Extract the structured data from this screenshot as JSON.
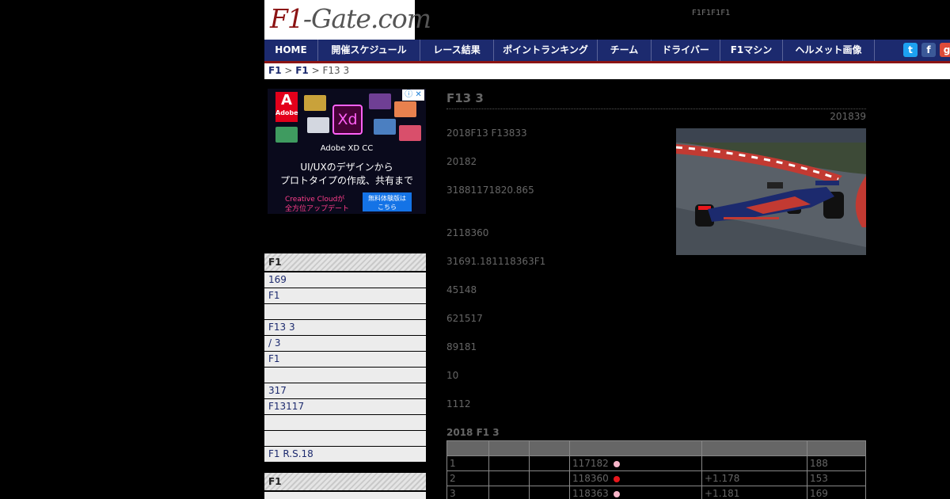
{
  "header": {
    "logo_f1": "F1",
    "logo_rest": "-Gate.com",
    "tagline": "F1F1F1F1"
  },
  "nav": {
    "items": [
      {
        "label": "HOME"
      },
      {
        "label": "開催スケジュール"
      },
      {
        "label": "レース結果"
      },
      {
        "label": "ポイントランキング"
      },
      {
        "label": "チーム"
      },
      {
        "label": "ドライバー"
      },
      {
        "label": "F1マシン"
      },
      {
        "label": "ヘルメット画像"
      }
    ],
    "social": [
      {
        "icon": "twitter-icon",
        "glyph": "t",
        "color": "#1da1f2"
      },
      {
        "icon": "facebook-icon",
        "glyph": "f",
        "color": "#3b5998"
      },
      {
        "icon": "googleplus-icon",
        "glyph": "g",
        "color": "#dd4b39"
      }
    ]
  },
  "breadcrumb": {
    "link1": "F1",
    "link2": "F1",
    "sep": " > ",
    "current": "F13 3"
  },
  "ad": {
    "brand": "Adobe",
    "xd_glyph": "Xd",
    "product": "Adobe XD CC",
    "headline1": "UI/UXのデザインから",
    "headline2": "プロトタイプの作成、共有まで",
    "cc_line1": "Creative Cloudが",
    "cc_line2": "全方位アップデート",
    "button_line1": "無料体験版は",
    "button_line2": "こちら",
    "info": "ⓘ ✕"
  },
  "sidebar": {
    "heading1": "F1",
    "items": [
      " 169",
      "F1",
      "",
      "F13 3",
      "  / 3",
      " F1",
      "",
      "317",
      "F13117",
      "",
      "",
      "F1 R.S.18"
    ],
    "heading2": "F1"
  },
  "article": {
    "title": "F13 3",
    "date": "201839",
    "paragraphs": [
      "2018F13 F13833",
      "20182",
      "31881171820.865",
      "2118360",
      "31691.181118363F1",
      "45148",
      "621517",
      "89181",
      "10",
      "1112"
    ],
    "table_title": "2018 F1 3",
    "table_rows": [
      {
        "pos": "1",
        "time": "117182",
        "dot": "#f7b5c8",
        "gap": "",
        "laps": "188"
      },
      {
        "pos": "2",
        "time": "118360",
        "dot": "#e8171c",
        "gap": "+1.178",
        "laps": "153"
      },
      {
        "pos": "3",
        "time": "118363",
        "dot": "#f7b5c8",
        "gap": "+1.181",
        "laps": "169"
      }
    ]
  }
}
